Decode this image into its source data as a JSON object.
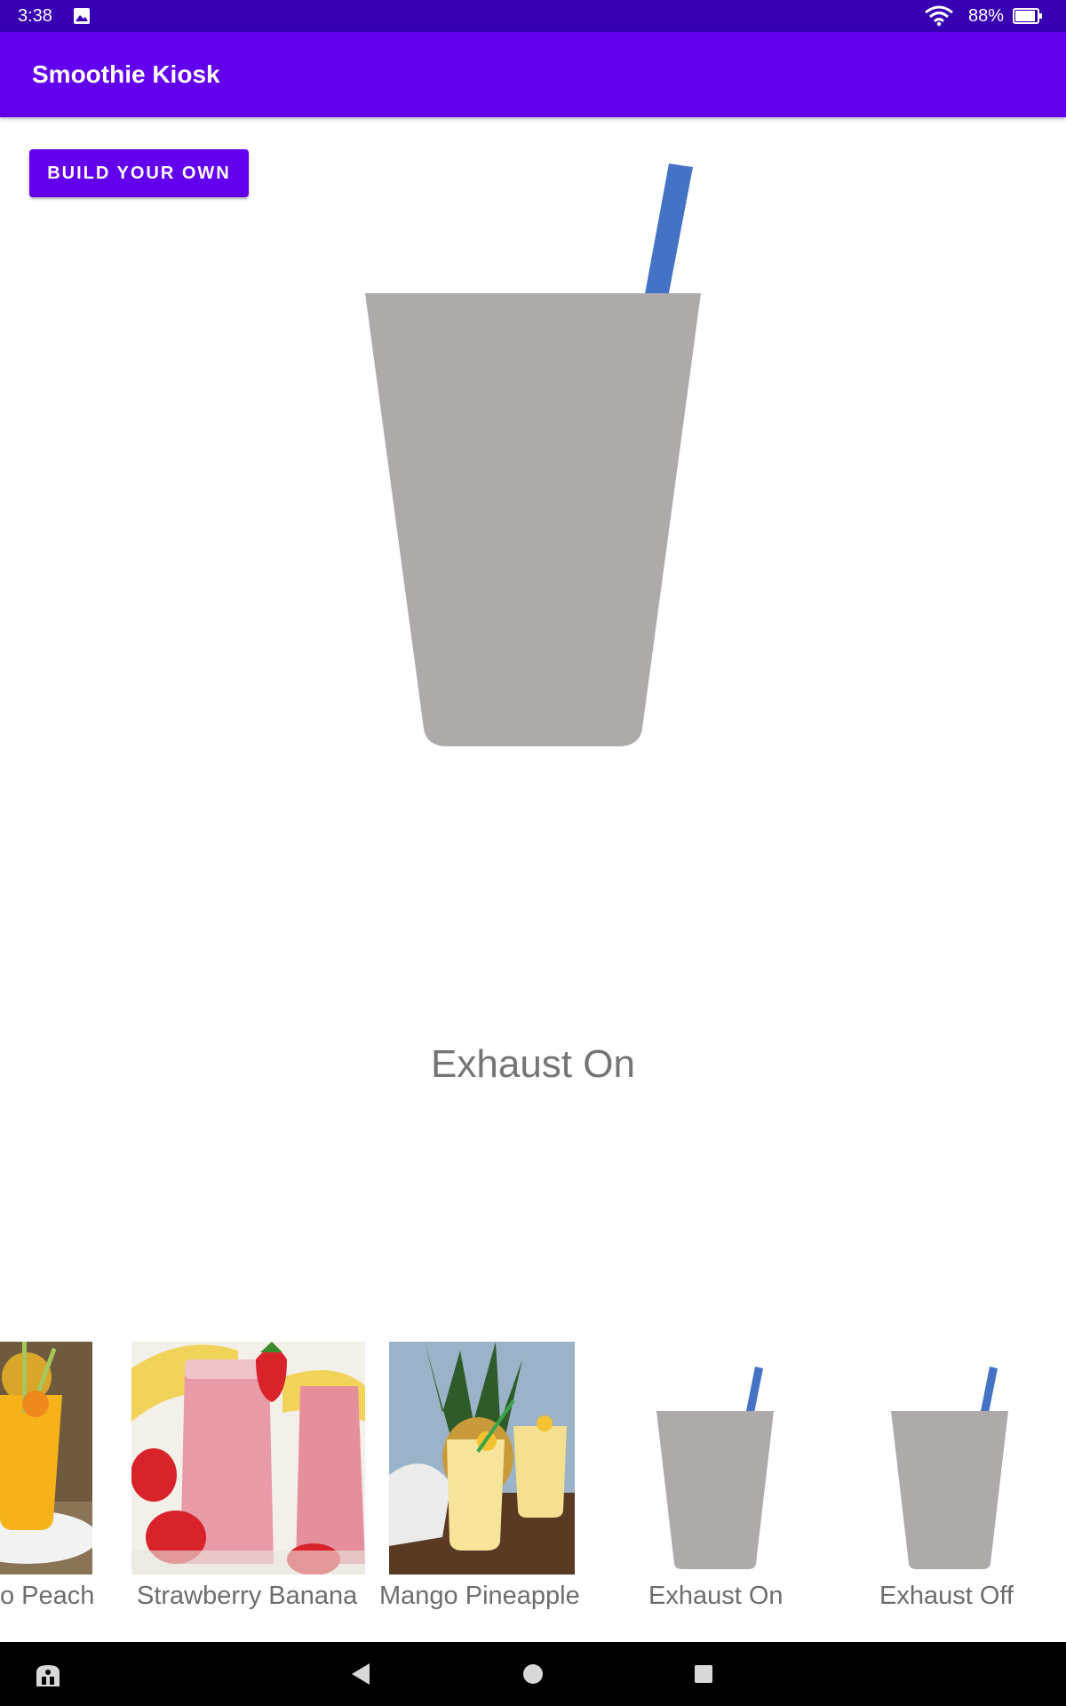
{
  "status_bar": {
    "time": "3:38",
    "battery": "88%",
    "icons": [
      "photo-icon",
      "wifi-icon",
      "battery-icon"
    ]
  },
  "app_bar": {
    "title": "Smoothie Kiosk"
  },
  "build_button": {
    "label": "BUILD YOUR OWN"
  },
  "main": {
    "status_text": "Exhaust On",
    "cup_color": "#aeaaaa",
    "straw_color": "#4472c4"
  },
  "carousel": {
    "items": [
      {
        "label": "Mango Peach",
        "visible_label": "o Peach",
        "kind": "photo"
      },
      {
        "label": "Strawberry Banana",
        "kind": "photo"
      },
      {
        "label": "Mango Pineapple",
        "kind": "photo"
      },
      {
        "label": "Exhaust On",
        "kind": "cup"
      },
      {
        "label": "Exhaust Off",
        "kind": "cup"
      }
    ]
  },
  "nav_bar": {
    "icons": [
      "accessibility-icon",
      "back-icon",
      "home-icon",
      "recents-icon"
    ]
  },
  "colors": {
    "primary": "#6200ee",
    "primary_dark": "#3700b3",
    "label_gray": "#757575"
  }
}
